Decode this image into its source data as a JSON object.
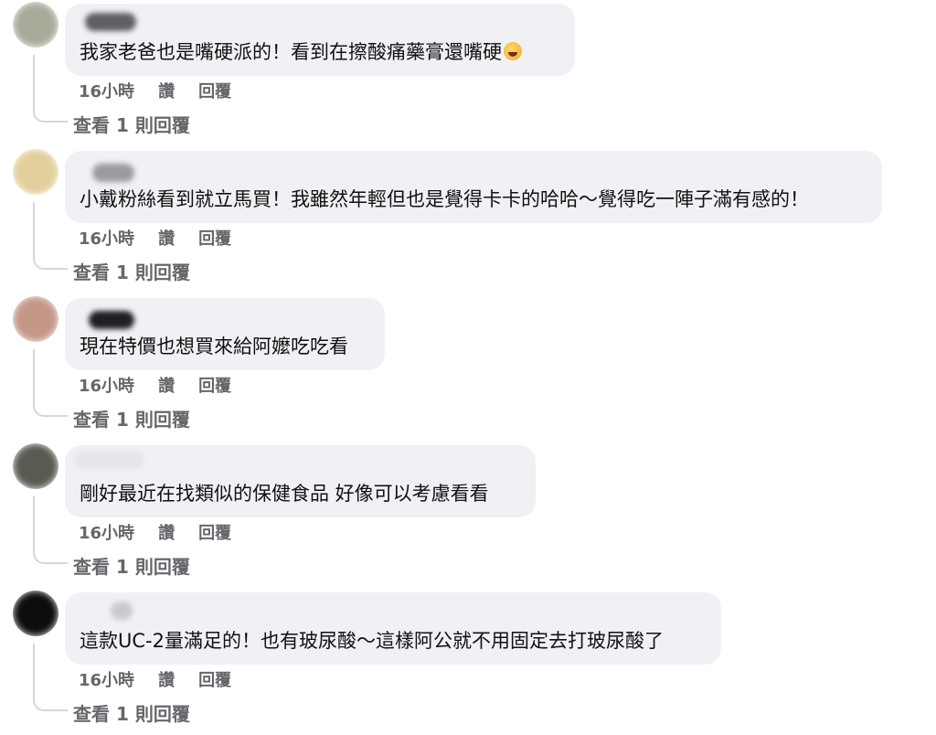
{
  "comments": [
    {
      "text": "我家老爸也是嘴硬派的！看到在擦酸痛藥膏還嘴硬",
      "emoji": "rolling-on-floor-laughing-emoji",
      "time": "16小時",
      "like": "讚",
      "reply": "回覆",
      "view_replies": "查看 1 則回覆",
      "avatar_color": "#a9ab9a",
      "name_color": "#5f6066"
    },
    {
      "text": "小戴粉絲看到就立馬買！我雖然年輕但也是覺得卡卡的哈哈～覺得吃一陣子滿有感的！",
      "time": "16小時",
      "like": "讚",
      "reply": "回覆",
      "view_replies": "查看 1 則回覆",
      "avatar_color": "#e2cf9b",
      "name_color": "#9b9ca0"
    },
    {
      "text": "現在特價也想買來給阿嬤吃吃看",
      "time": "16小時",
      "like": "讚",
      "reply": "回覆",
      "view_replies": "查看 1 則回覆",
      "avatar_color": "#c49787",
      "name_color": "#1f2023"
    },
    {
      "text": "剛好最近在找類似的保健食品 好像可以考慮看看",
      "time": "16小時",
      "like": "讚",
      "reply": "回覆",
      "view_replies": "查看 1 則回覆",
      "avatar_color": "#5a5a52",
      "name_color": "#e4e5e8"
    },
    {
      "text": "這款UC-2量滿足的！也有玻尿酸～這樣阿公就不用固定去打玻尿酸了",
      "time": "16小時",
      "like": "讚",
      "reply": "回覆",
      "view_replies": "查看 1 則回覆",
      "avatar_color": "#0d0d0b",
      "name_color": "#c9cacd"
    }
  ]
}
